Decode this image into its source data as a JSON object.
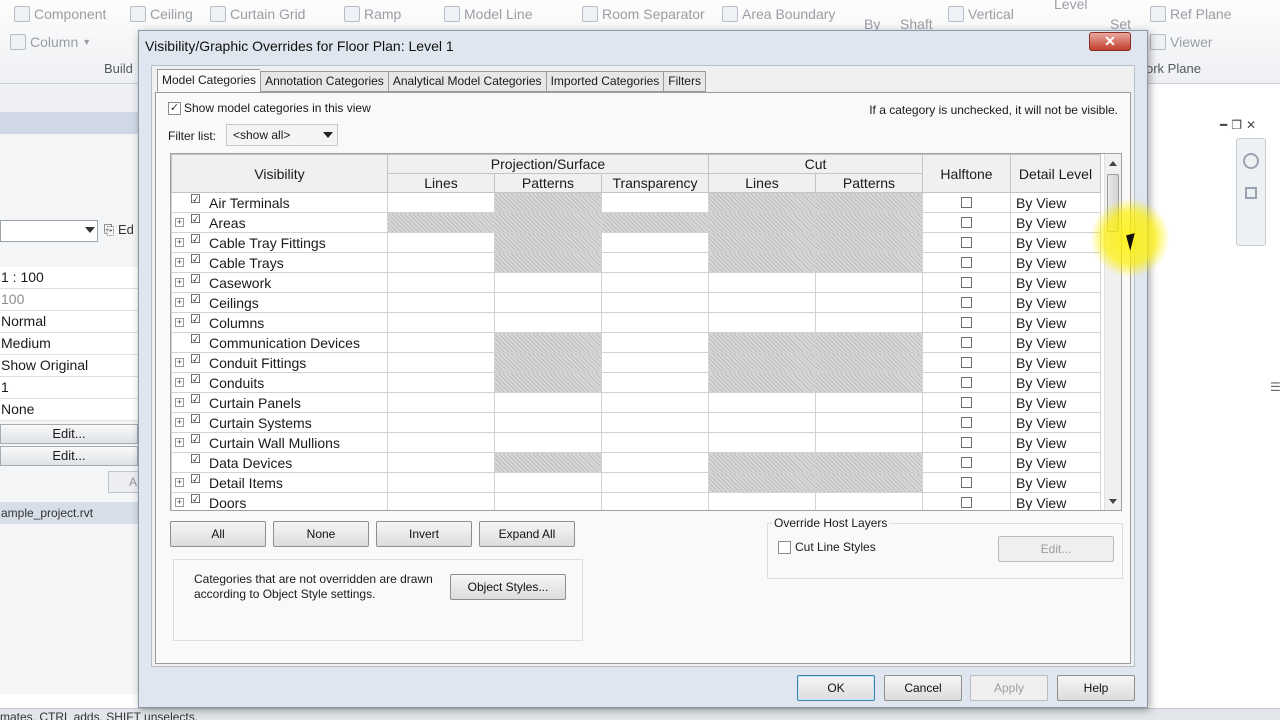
{
  "ribbon": {
    "row1": [
      "Component",
      "Ceiling",
      "Curtain Grid",
      "Ramp",
      "Model Line",
      "Room Separator",
      "Area Boundary",
      "By",
      "Shaft",
      "Vertical",
      "Level",
      "Set",
      "Ref Plane"
    ],
    "row2": [
      "Column",
      "Viewer"
    ],
    "groups": [
      "Build",
      "ork Plane"
    ]
  },
  "properties": {
    "type_edit": "Ed",
    "rows": [
      "1 : 100",
      "100",
      "Normal",
      "Medium",
      "Show Original",
      "1",
      "None"
    ],
    "edit_buttons": [
      "Edit...",
      "Edit..."
    ],
    "apply": "A",
    "browser_item": "ample_project.rvt"
  },
  "status_bar": {
    "text": "mates. CTRL adds, SHIFT unselects."
  },
  "dialog": {
    "title": "Visibility/Graphic Overrides for Floor Plan: Level 1",
    "close_label": "✕",
    "tabs": [
      {
        "label": "Model Categories",
        "active": true
      },
      {
        "label": "Annotation Categories",
        "active": false
      },
      {
        "label": "Analytical Model Categories",
        "active": false
      },
      {
        "label": "Imported Categories",
        "active": false
      },
      {
        "label": "Filters",
        "active": false
      }
    ],
    "show_categories_label": "Show model categories in this view",
    "hint": "If a category is unchecked, it will not be visible.",
    "filter_label": "Filter list:",
    "filter_value": "<show all>",
    "table": {
      "headers": {
        "visibility": "Visibility",
        "projection_surface": "Projection/Surface",
        "cut": "Cut",
        "halftone": "Halftone",
        "detail_level": "Detail Level",
        "lines": "Lines",
        "patterns": "Patterns",
        "transparency": "Transparency"
      },
      "rows": [
        {
          "name": "Air Terminals",
          "expandable": false,
          "checked": true,
          "proj_lines_na": false,
          "proj_patterns_na": true,
          "transparency_na": false,
          "cut_lines_na": true,
          "cut_patterns_na": true,
          "detail": "By View"
        },
        {
          "name": "Areas",
          "expandable": true,
          "checked": true,
          "proj_lines_na": true,
          "proj_patterns_na": true,
          "transparency_na": true,
          "cut_lines_na": true,
          "cut_patterns_na": true,
          "detail": "By View"
        },
        {
          "name": "Cable Tray Fittings",
          "expandable": true,
          "checked": true,
          "proj_lines_na": false,
          "proj_patterns_na": true,
          "transparency_na": false,
          "cut_lines_na": true,
          "cut_patterns_na": true,
          "detail": "By View"
        },
        {
          "name": "Cable Trays",
          "expandable": true,
          "checked": true,
          "proj_lines_na": false,
          "proj_patterns_na": true,
          "transparency_na": false,
          "cut_lines_na": true,
          "cut_patterns_na": true,
          "detail": "By View"
        },
        {
          "name": "Casework",
          "expandable": true,
          "checked": true,
          "proj_lines_na": false,
          "proj_patterns_na": false,
          "transparency_na": false,
          "cut_lines_na": false,
          "cut_patterns_na": false,
          "detail": "By View"
        },
        {
          "name": "Ceilings",
          "expandable": true,
          "checked": true,
          "proj_lines_na": false,
          "proj_patterns_na": false,
          "transparency_na": false,
          "cut_lines_na": false,
          "cut_patterns_na": false,
          "detail": "By View"
        },
        {
          "name": "Columns",
          "expandable": true,
          "checked": true,
          "proj_lines_na": false,
          "proj_patterns_na": false,
          "transparency_na": false,
          "cut_lines_na": false,
          "cut_patterns_na": false,
          "detail": "By View"
        },
        {
          "name": "Communication Devices",
          "expandable": false,
          "checked": true,
          "proj_lines_na": false,
          "proj_patterns_na": true,
          "transparency_na": false,
          "cut_lines_na": true,
          "cut_patterns_na": true,
          "detail": "By View"
        },
        {
          "name": "Conduit Fittings",
          "expandable": true,
          "checked": true,
          "proj_lines_na": false,
          "proj_patterns_na": true,
          "transparency_na": false,
          "cut_lines_na": true,
          "cut_patterns_na": true,
          "detail": "By View"
        },
        {
          "name": "Conduits",
          "expandable": true,
          "checked": true,
          "proj_lines_na": false,
          "proj_patterns_na": true,
          "transparency_na": false,
          "cut_lines_na": true,
          "cut_patterns_na": true,
          "detail": "By View"
        },
        {
          "name": "Curtain Panels",
          "expandable": true,
          "checked": true,
          "proj_lines_na": false,
          "proj_patterns_na": false,
          "transparency_na": false,
          "cut_lines_na": false,
          "cut_patterns_na": false,
          "detail": "By View"
        },
        {
          "name": "Curtain Systems",
          "expandable": true,
          "checked": true,
          "proj_lines_na": false,
          "proj_patterns_na": false,
          "transparency_na": false,
          "cut_lines_na": false,
          "cut_patterns_na": false,
          "detail": "By View"
        },
        {
          "name": "Curtain Wall Mullions",
          "expandable": true,
          "checked": true,
          "proj_lines_na": false,
          "proj_patterns_na": false,
          "transparency_na": false,
          "cut_lines_na": false,
          "cut_patterns_na": false,
          "detail": "By View"
        },
        {
          "name": "Data Devices",
          "expandable": false,
          "checked": true,
          "proj_lines_na": false,
          "proj_patterns_na": true,
          "transparency_na": false,
          "cut_lines_na": true,
          "cut_patterns_na": true,
          "detail": "By View"
        },
        {
          "name": "Detail Items",
          "expandable": true,
          "checked": true,
          "proj_lines_na": false,
          "proj_patterns_na": false,
          "transparency_na": false,
          "cut_lines_na": true,
          "cut_patterns_na": true,
          "detail": "By View"
        },
        {
          "name": "Doors",
          "expandable": true,
          "checked": true,
          "proj_lines_na": false,
          "proj_patterns_na": false,
          "transparency_na": false,
          "cut_lines_na": false,
          "cut_patterns_na": false,
          "detail": "By View"
        }
      ]
    },
    "buttons": {
      "all": "All",
      "none": "None",
      "invert": "Invert",
      "expand_all": "Expand All",
      "object_styles": "Object Styles...",
      "edit": "Edit...",
      "ok": "OK",
      "cancel": "Cancel",
      "apply": "Apply",
      "help": "Help"
    },
    "override_host_layers": {
      "title": "Override Host Layers",
      "cut_line_styles": "Cut Line Styles"
    },
    "note": "Categories that are not overridden are drawn according to Object Style settings."
  }
}
